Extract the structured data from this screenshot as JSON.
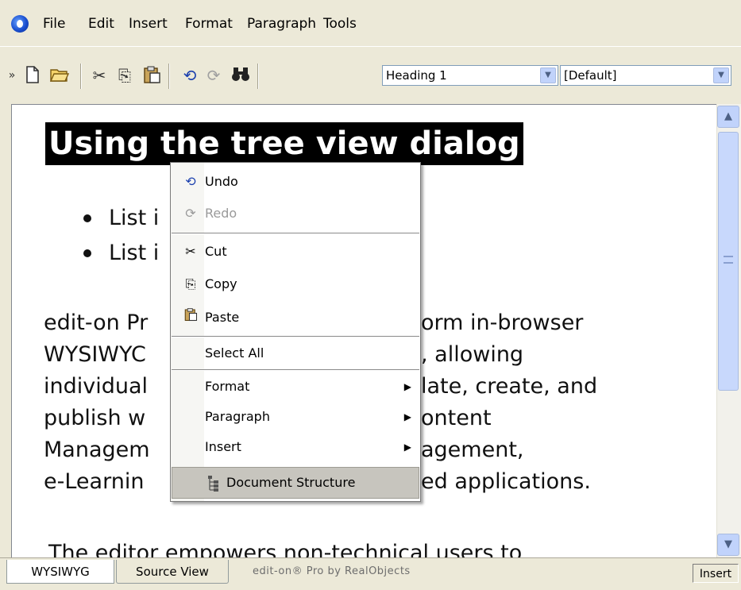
{
  "menubar": {
    "items": [
      "File",
      "Edit",
      "Insert",
      "Format",
      "Paragraph",
      "Tools"
    ]
  },
  "toolbar": {
    "icons": [
      "overflow-chevron-icon",
      "new-document-icon",
      "open-folder-icon",
      "cut-icon",
      "copy-icon",
      "paste-icon",
      "undo-icon",
      "redo-icon",
      "find-binoculars-icon"
    ],
    "paragraph_style": "Heading 1",
    "font_style": "[Default]"
  },
  "document": {
    "heading": "Using the tree view dialog",
    "list_items": [
      "List i",
      "List i"
    ],
    "paragraph1_lines": [
      {
        "left": "edit-on Pr",
        "right": "orm in-browser"
      },
      {
        "left": "WYSIWYC",
        "right": ", allowing"
      },
      {
        "left": "individual",
        "right": "late, create, and"
      },
      {
        "left": "publish w",
        "right": "ontent"
      },
      {
        "left": "Managem",
        "right": "agement,"
      },
      {
        "left": "e-Learnin",
        "right": "ed applications."
      }
    ],
    "paragraph2_partial": "The editor empowers non-technical users to"
  },
  "context_menu": {
    "items": [
      {
        "label": "Undo",
        "icon": "undo-icon",
        "glyph": "⟲",
        "disabled": false
      },
      {
        "label": "Redo",
        "icon": "redo-icon",
        "glyph": "⟳",
        "disabled": true
      },
      {
        "label": "Cut",
        "icon": "cut-icon",
        "glyph": "✂",
        "disabled": false
      },
      {
        "label": "Copy",
        "icon": "copy-icon",
        "glyph": "⎘",
        "disabled": false
      },
      {
        "label": "Paste",
        "icon": "paste-icon",
        "glyph": "📋",
        "disabled": false
      },
      {
        "label": "Select All"
      },
      {
        "label": "Format",
        "submenu": true
      },
      {
        "label": "Paragraph",
        "submenu": true
      },
      {
        "label": "Insert",
        "submenu": true
      },
      {
        "label": "Document Structure",
        "icon": "tree-structure-icon",
        "highlighted": true
      }
    ]
  },
  "statusbar": {
    "tabs": [
      "WYSIWYG",
      "Source View"
    ],
    "active_tab": "WYSIWYG",
    "brand": "edit-on® Pro by RealObjects",
    "mode": "Insert"
  }
}
